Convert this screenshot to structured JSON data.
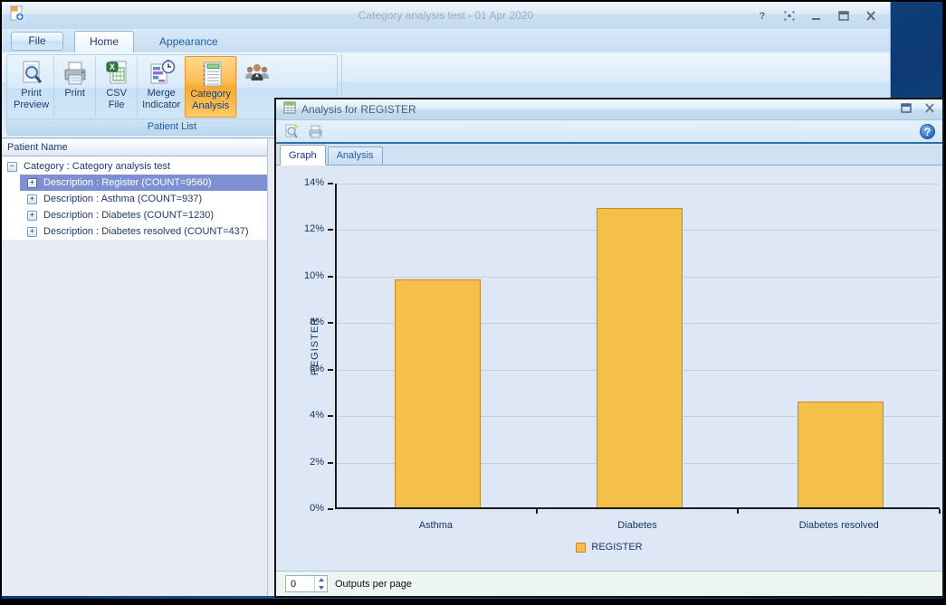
{
  "main_window": {
    "title": "Category analysis test - 01 Apr 2020",
    "titlebar_buttons": [
      "help-icon",
      "fullscreen-icon",
      "minimize-icon",
      "maximize-icon",
      "close-icon"
    ],
    "file_tab": "File",
    "home_tab": "Home",
    "appearance_tab": "Appearance",
    "ribbon": {
      "group_label": "Patient List",
      "buttons": [
        {
          "icon": "print-preview-icon",
          "lines": [
            "Print",
            "Preview"
          ]
        },
        {
          "icon": "print-icon",
          "lines": [
            "Print"
          ]
        },
        {
          "icon": "csv-file-icon",
          "lines": [
            "CSV",
            "File"
          ]
        },
        {
          "icon": "merge-indicator-icon",
          "lines": [
            "Merge",
            "Indicator"
          ]
        },
        {
          "icon": "category-analysis-icon",
          "lines": [
            "Category",
            "Analysis"
          ],
          "active": true
        },
        {
          "icon": "users-icon",
          "lines": []
        }
      ]
    },
    "tree": {
      "header": "Patient Name",
      "root": {
        "label": "Category : Category analysis test",
        "expanded": true
      },
      "items": [
        {
          "label": "Description : Register (COUNT=9560)",
          "selected": true
        },
        {
          "label": "Description : Asthma (COUNT=937)"
        },
        {
          "label": "Description : Diabetes (COUNT=1230)"
        },
        {
          "label": "Description : Diabetes resolved (COUNT=437)"
        }
      ]
    }
  },
  "analysis_window": {
    "title": "Analysis for REGISTER",
    "titlebar_buttons": [
      "maximize-icon",
      "close-icon"
    ],
    "toolbar_icons": [
      "print-preview-icon",
      "print-icon",
      "help-icon"
    ],
    "tabs": [
      {
        "label": "Graph",
        "active": true
      },
      {
        "label": "Analysis"
      }
    ],
    "footer": {
      "spinner_value": "0",
      "label": "Outputs per page"
    }
  },
  "chart_data": {
    "type": "bar",
    "categories": [
      "Asthma",
      "Diabetes",
      "Diabetes resolved"
    ],
    "series": [
      {
        "name": "REGISTER",
        "values": [
          9.8,
          12.87,
          4.57
        ]
      }
    ],
    "title": "",
    "xlabel": "",
    "ylabel": "REGISTER",
    "ylim": [
      0,
      14
    ],
    "ytick_step": 2,
    "ytick_suffix": "%",
    "grid": true,
    "legend_position": "bottom",
    "legend_entries": [
      "REGISTER"
    ],
    "bar_color": "#F5C04A",
    "bar_border": "#C8882B",
    "plot_bg": "#DEE7F6"
  },
  "colors": {
    "selected_row": "#7D90D2",
    "active_ribbon_button": "#F9A930",
    "desktop": "#15497F"
  }
}
